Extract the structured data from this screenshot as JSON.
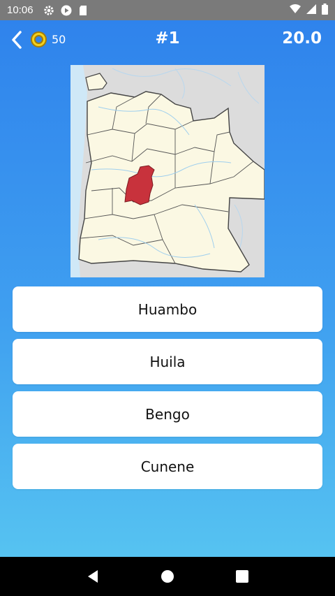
{
  "status_bar": {
    "time": "10:06",
    "icons": [
      "gear-icon",
      "play-circle-icon",
      "sd-card-icon",
      "wifi-icon",
      "signal-icon",
      "battery-icon"
    ]
  },
  "header": {
    "back_icon": "chevron-left-icon",
    "coin_icon": "coin-icon",
    "coins": "50",
    "question_number": "#1",
    "timer": "20.0"
  },
  "map": {
    "highlighted_region_color": "#c8323c",
    "land_color": "#fbf8e3",
    "sea_color": "#cfe8f7",
    "neighbor_color": "#dcdcdc"
  },
  "answers": [
    {
      "label": "Huambo"
    },
    {
      "label": "Huila"
    },
    {
      "label": "Bengo"
    },
    {
      "label": "Cunene"
    }
  ],
  "nav_bar": {
    "icons": [
      "back-triangle-icon",
      "home-circle-icon",
      "recents-square-icon"
    ]
  },
  "colors": {
    "status_bar": "#7a7a7a",
    "gradient_top": "#2f83ec",
    "gradient_bottom": "#56c3f1",
    "answer_bg": "#ffffff",
    "nav_bar": "#000000"
  }
}
